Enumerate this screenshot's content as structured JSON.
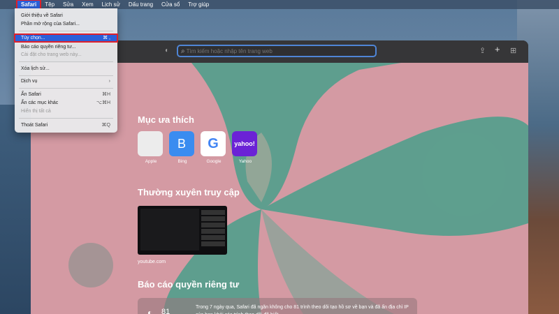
{
  "menubar": {
    "apple_icon": "apple-logo-icon",
    "items": [
      "Safari",
      "Tệp",
      "Sửa",
      "Xem",
      "Lịch sử",
      "Dấu trang",
      "Cửa sổ",
      "Trợ giúp"
    ]
  },
  "safari_menu": {
    "items": [
      {
        "label": "Giới thiệu về Safari",
        "shortcut": ""
      },
      {
        "label": "Phần mở rộng của Safari...",
        "shortcut": ""
      },
      {
        "label": "Tùy chọn...",
        "shortcut": "⌘ ,"
      },
      {
        "label": "Báo cáo quyền riêng tư...",
        "shortcut": ""
      },
      {
        "label": "Cài đặt cho trang web này...",
        "shortcut": ""
      },
      {
        "label": "Xóa lịch sử...",
        "shortcut": ""
      },
      {
        "label": "Dịch vụ",
        "shortcut": "›"
      },
      {
        "label": "Ẩn Safari",
        "shortcut": "⌘H"
      },
      {
        "label": "Ẩn các mục khác",
        "shortcut": "⌥⌘H"
      },
      {
        "label": "Hiển thị tất cả",
        "shortcut": ""
      },
      {
        "label": "Thoát Safari",
        "shortcut": "⌘Q"
      }
    ]
  },
  "toolbar": {
    "search_placeholder": "Tìm kiếm hoặc nhập tên trang web"
  },
  "favorites": {
    "title": "Mục ưa thích",
    "items": [
      {
        "name": "Apple",
        "glyph": ""
      },
      {
        "name": "Bing",
        "glyph": "B"
      },
      {
        "name": "Google",
        "glyph": "G"
      },
      {
        "name": "Yahoo",
        "glyph": "yahoo!"
      }
    ]
  },
  "frequent": {
    "title": "Thường xuyên truy cập",
    "items": [
      {
        "label": "youtube.com"
      }
    ]
  },
  "privacy": {
    "title": "Báo cáo quyền riêng tư",
    "count": "81",
    "text": "Trong 7 ngày qua, Safari đã ngăn không cho 81 trình theo dõi tạo hồ sơ về bạn và đã ẩn địa chỉ IP của bạn khỏi các trình theo dõi đã biết."
  },
  "colors": {
    "accent": "#2b5fd9",
    "highlight_outline": "#e0202a",
    "page_pink": "#d49aa3",
    "page_teal": "#5e9e8e"
  }
}
